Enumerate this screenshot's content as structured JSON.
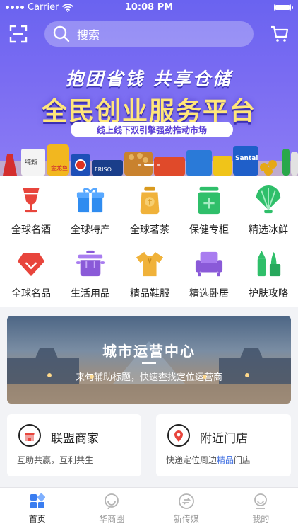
{
  "status_bar": {
    "carrier": "Carrier",
    "time": "10:08 PM"
  },
  "header": {
    "search_placeholder": "搜索",
    "scan_icon": "scan-icon",
    "cart_icon": "cart-icon"
  },
  "hero": {
    "slogan": "抱团省钱 共享仓储",
    "title": "全民创业服务平台",
    "tagline": "线上线下双引擎强劲推动市场",
    "product_labels": [
      "纯甄",
      "金龙鱼",
      "Santal",
      "FRISO"
    ],
    "page_count": 3,
    "active_page": 1
  },
  "categories": [
    {
      "label": "全球名酒",
      "icon": "wine-glass-icon",
      "color": "#e8453c"
    },
    {
      "label": "全球特产",
      "icon": "gift-icon",
      "color": "#2f8cf0"
    },
    {
      "label": "全球茗茶",
      "icon": "tea-jar-icon",
      "color": "#f0b23a"
    },
    {
      "label": "保健专柜",
      "icon": "medicine-icon",
      "color": "#2fbf6a"
    },
    {
      "label": "精选冰鲜",
      "icon": "shell-icon",
      "color": "#2fbf6a"
    },
    {
      "label": "全球名品",
      "icon": "diamond-icon",
      "color": "#e8453c"
    },
    {
      "label": "生活用品",
      "icon": "pot-icon",
      "color": "#8a5ad8"
    },
    {
      "label": "精品鞋服",
      "icon": "tshirt-icon",
      "color": "#f0b23a"
    },
    {
      "label": "精选卧居",
      "icon": "sofa-icon",
      "color": "#8a5ad8"
    },
    {
      "label": "护肤攻略",
      "icon": "cosmetics-icon",
      "color": "#2fbf6a"
    }
  ],
  "banner": {
    "title": "城市运营中心",
    "subtitle": "来句辅助标题，快速查找定位运营商"
  },
  "cards": [
    {
      "title": "联盟商家",
      "subtitle": "互助共赢，互利共生",
      "icon": "store-icon",
      "color": "#e8453c"
    },
    {
      "title": "附近门店",
      "subtitle_pre": "快递定位周边",
      "subtitle_hl": "精品",
      "subtitle_post": "门店",
      "icon": "location-pin-icon",
      "color": "#e8453c"
    }
  ],
  "tabbar": [
    {
      "label": "首页",
      "icon": "home-grid-icon",
      "active": true
    },
    {
      "label": "华商圈",
      "icon": "chat-bubble-icon",
      "active": false
    },
    {
      "label": "新传媒",
      "icon": "refresh-icon",
      "active": false
    },
    {
      "label": "我的",
      "icon": "profile-icon",
      "active": false
    }
  ],
  "colors": {
    "primary": "#6a63f0",
    "accent_yellow": "#ffe67a",
    "link_blue": "#3a6be0"
  }
}
